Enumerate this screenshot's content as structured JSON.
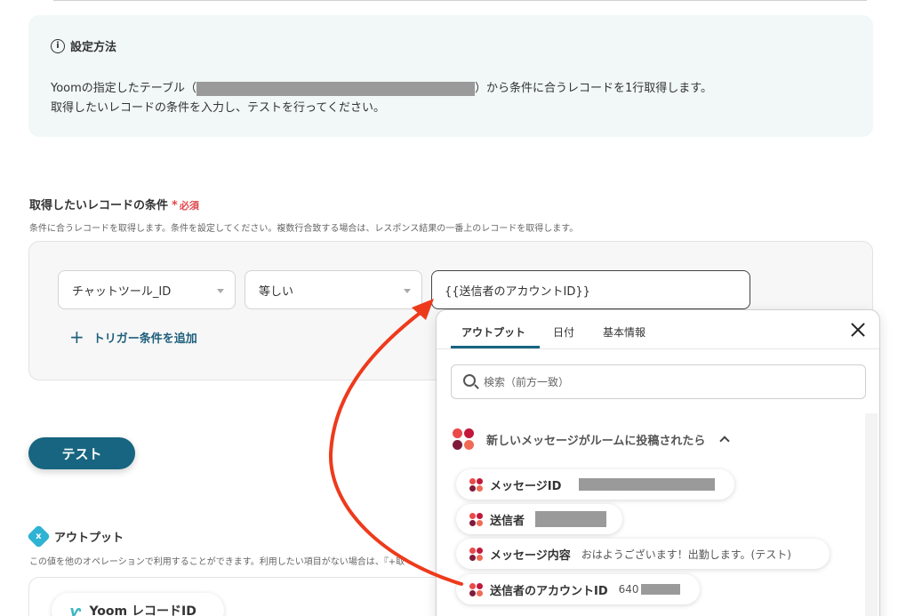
{
  "setup": {
    "title": "設定方法",
    "line1_prefix": "Yoomの指定したテーブル（",
    "line1_suffix": "）から条件に合うレコードを1行取得します。",
    "line2": "取得したいレコードの条件を入力し、テストを行ってください。"
  },
  "condition": {
    "label": "取得したいレコードの条件",
    "required_mark": "*",
    "required_text": "必須",
    "description": "条件に合うレコードを取得します。条件を設定してください。複数行合致する場合は、レスポンス結果の一番上のレコードを取得します。",
    "field_value": "チャットツール_ID",
    "operator_value": "等しい",
    "value_input": "{{送信者のアカウントID}}",
    "add_trigger_label": "トリガー条件を追加"
  },
  "test_button_label": "テスト",
  "output": {
    "title": "アウトプット",
    "icon_glyph": "x",
    "description": "この値を他のオペレーションで利用することができます。利用したい項目がない場合は、『+取",
    "record_chip_label": "Yoom レコードID"
  },
  "popover": {
    "tabs": [
      "アウトプット",
      "日付",
      "基本情報"
    ],
    "active_tab": "アウトプット",
    "search_placeholder": "検索（前方一致）",
    "group_title": "新しいメッセージがルームに投稿されたら",
    "items": [
      {
        "label": "メッセージID",
        "value": ""
      },
      {
        "label": "送信者",
        "value": ""
      },
      {
        "label": "メッセージ内容",
        "value": "おはようございます！出勤します。(テスト)"
      },
      {
        "label": "送信者のアカウントID",
        "value": "640"
      }
    ]
  },
  "colors": {
    "accent": "#176580",
    "required": "#e2474b",
    "arrow": "#ee3a1c",
    "info_bg": "#f1f8f7"
  },
  "icons": [
    "info-icon",
    "caret-down-icon",
    "plus-icon",
    "close-icon",
    "search-icon",
    "chevron-up-icon",
    "chatwork-icon",
    "output-icon",
    "yoom-icon"
  ]
}
